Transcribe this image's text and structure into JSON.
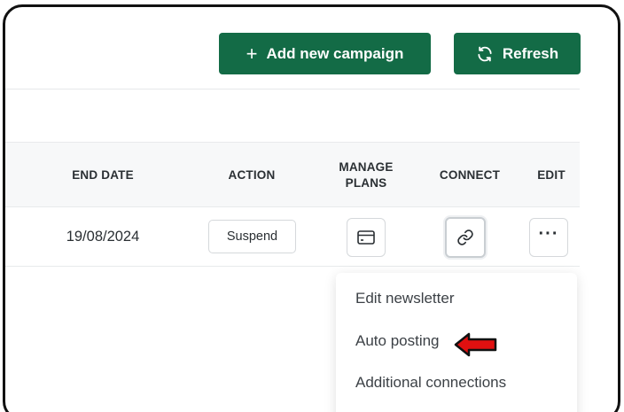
{
  "toolbar": {
    "add_campaign_label": "Add new campaign",
    "add_icon": "+",
    "refresh_label": "Refresh"
  },
  "table": {
    "headers": {
      "end_date": "END DATE",
      "action": "ACTION",
      "manage_plans_line1": "MANAGE",
      "manage_plans_line2": "PLANS",
      "connect": "CONNECT",
      "edit": "EDIT"
    },
    "rows": [
      {
        "end_date": "19/08/2024",
        "action_label": "Suspend",
        "edit_more": "···"
      }
    ]
  },
  "dropdown": {
    "items": [
      "Edit newsletter",
      "Auto posting",
      "Additional connections"
    ]
  },
  "colors": {
    "brand_green": "#136b46",
    "annotation_red": "#e01010"
  },
  "icons": [
    "plus-icon",
    "refresh-icon",
    "card-icon",
    "link-icon",
    "more-icon",
    "red-arrow-icon"
  ]
}
